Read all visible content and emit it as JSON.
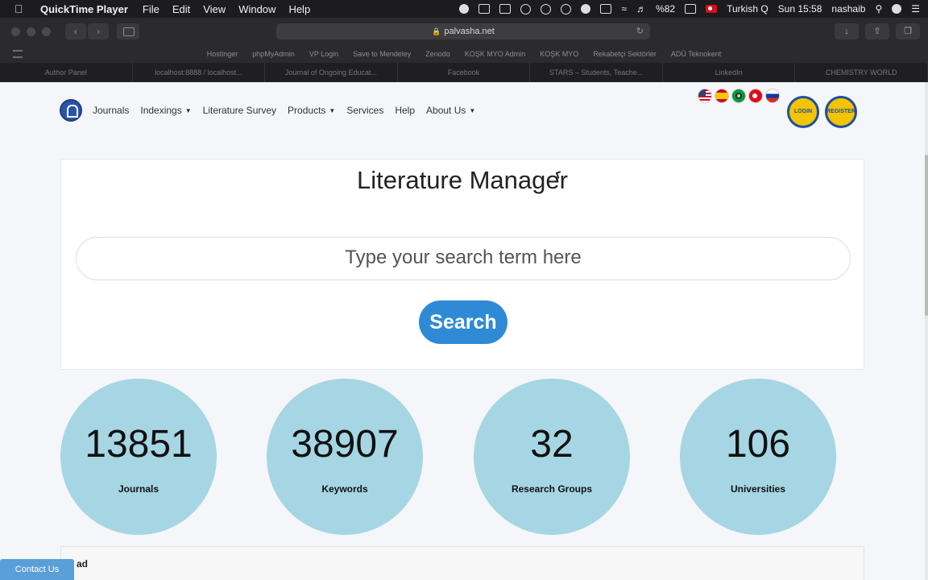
{
  "menubar": {
    "app_name": "QuickTime Player",
    "menus": [
      "File",
      "Edit",
      "View",
      "Window",
      "Help"
    ],
    "status": {
      "battery": "%82",
      "input_source": "Turkish Q",
      "clock": "Sun 15:58",
      "user": "nashaib"
    }
  },
  "browser": {
    "url": "palvasha.net",
    "bookmarks": [
      "Hostinger",
      "phpMyAdmin",
      "VP Login",
      "Save to Mendeley",
      "Zenodo",
      "KOŞK MYO Admin",
      "KOŞK MYO",
      "Rekabetçi Sektörler",
      "ADÜ Teknokent"
    ],
    "tabs": [
      "Author Panel",
      "localhost:8888 / localhost...",
      "Journal of Ongoing Educat...",
      "Facebook",
      "STARS – Students, Teache...",
      "LinkedIn",
      "CHEMISTRY WORLD"
    ]
  },
  "nav": {
    "links": [
      {
        "label": "Journals",
        "dropdown": false
      },
      {
        "label": "Indexings",
        "dropdown": true
      },
      {
        "label": "Literature Survey",
        "dropdown": false
      },
      {
        "label": "Products",
        "dropdown": true
      },
      {
        "label": "Services",
        "dropdown": false
      },
      {
        "label": "Help",
        "dropdown": false
      },
      {
        "label": "About Us",
        "dropdown": true
      }
    ],
    "login_label": "LOGIN",
    "register_label": "REGISTER"
  },
  "main": {
    "title": "Literature Manager",
    "search_placeholder": "Type your search term here",
    "search_button": "Search"
  },
  "stats": [
    {
      "value": "13851",
      "label": "Journals"
    },
    {
      "value": "38907",
      "label": "Keywords"
    },
    {
      "value": "32",
      "label": "Research Groups"
    },
    {
      "value": "106",
      "label": "Universities"
    }
  ],
  "panel": {
    "heading": "ad"
  },
  "contact_label": "Contact Us"
}
